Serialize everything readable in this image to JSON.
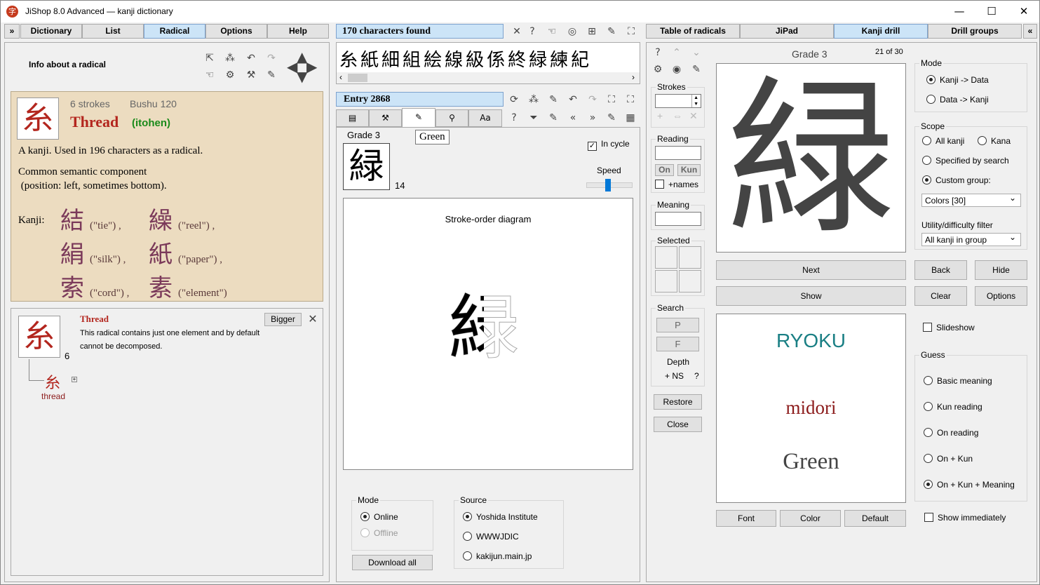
{
  "window": {
    "title": "JiShop 8.0 Advanced  —  kanji dictionary",
    "app_icon": "字",
    "minimize": "—",
    "maximize": "☐",
    "close": "✕"
  },
  "left": {
    "tabs": [
      "Dictionary",
      "List",
      "Radical",
      "Options",
      "Help"
    ],
    "info_label": "Info about a radical",
    "radical": {
      "glyph": "糸",
      "strokes": "6  strokes",
      "bushu": "Bushu  120",
      "name": "Thread",
      "reading": "(itohen)",
      "desc1": "A kanji. Used in 196 characters as a radical.",
      "desc2": "Common semantic component",
      "desc3": " (position: left, sometimes bottom).",
      "kanji_label": "Kanji:",
      "examples": [
        {
          "k": "結",
          "m": "(\"tie\") ,"
        },
        {
          "k": "繰",
          "m": "(\"reel\") ,"
        },
        {
          "k": "絹",
          "m": "(\"silk\") ,"
        },
        {
          "k": "紙",
          "m": "(\"paper\") ,"
        },
        {
          "k": "索",
          "m": "(\"cord\") ,"
        },
        {
          "k": "素",
          "m": "(\"element\")"
        }
      ]
    },
    "decomp": {
      "glyph": "糸",
      "count": "6",
      "title": "Thread",
      "text1": "This radical contains just one element and by default",
      "text2": "cannot be decomposed.",
      "bigger": "Bigger",
      "child_glyph": "糸",
      "child_label": "thread"
    }
  },
  "middle": {
    "found": "170 characters found",
    "chars": [
      "糸",
      "紙",
      "細",
      "組",
      "絵",
      "線",
      "級",
      "係",
      "終",
      "緑",
      "練",
      "紀"
    ],
    "entry": "Entry 2868",
    "tooltip": "Green",
    "grade": "Grade 3",
    "kanji": "緑",
    "strokes": "14",
    "in_cycle": "In cycle",
    "speed": "Speed",
    "speed_level": 0.45,
    "diagram_title": "Stroke-order diagram",
    "mode": {
      "legend": "Mode",
      "online": "Online",
      "offline": "Offline"
    },
    "source": {
      "legend": "Source",
      "options": [
        "Yoshida Institute",
        "WWWJDIC",
        "kakijun.main.jp"
      ]
    },
    "download": "Download all"
  },
  "search": {
    "strokes": "Strokes",
    "reading": "Reading",
    "on": "On",
    "kun": "Kun",
    "names": "+names",
    "meaning": "Meaning",
    "selected": "Selected",
    "search": "Search",
    "p": "P",
    "f": "F",
    "depth": "Depth",
    "ns": "+ NS",
    "q": "?",
    "restore": "Restore",
    "close": "Close"
  },
  "right": {
    "tabs": [
      "Table of radicals",
      "JiPad",
      "Kanji drill",
      "Drill groups"
    ],
    "grade": "Grade 3",
    "counter": "21 of 30",
    "kanji": "緑",
    "next": "Next",
    "show": "Show",
    "back": "Back",
    "hide": "Hide",
    "clear": "Clear",
    "options": "Options",
    "on_reading": "RYOKU",
    "kun_reading": "midori",
    "meaning": "Green",
    "font": "Font",
    "color": "Color",
    "default": "Default",
    "mode": {
      "legend": "Mode",
      "a": "Kanji -> Data",
      "b": "Data -> Kanji"
    },
    "scope": {
      "legend": "Scope",
      "all": "All kanji",
      "kana": "Kana",
      "spec": "Specified by search",
      "custom": "Custom group:",
      "group": "Colors [30]",
      "filter_label": "Utility/difficulty filter",
      "filter": "All kanji in group"
    },
    "slideshow": "Slideshow",
    "guess": {
      "legend": "Guess",
      "options": [
        "Basic meaning",
        "Kun reading",
        "On reading",
        "On + Kun",
        "On + Kun + Meaning"
      ]
    },
    "show_immediately": "Show immediately",
    "colors": {
      "on": "#1a7f84",
      "kun": "#8b1a1a",
      "meaning": "#444444",
      "radical": "#b3261e",
      "green": "#1a8a1a"
    }
  }
}
